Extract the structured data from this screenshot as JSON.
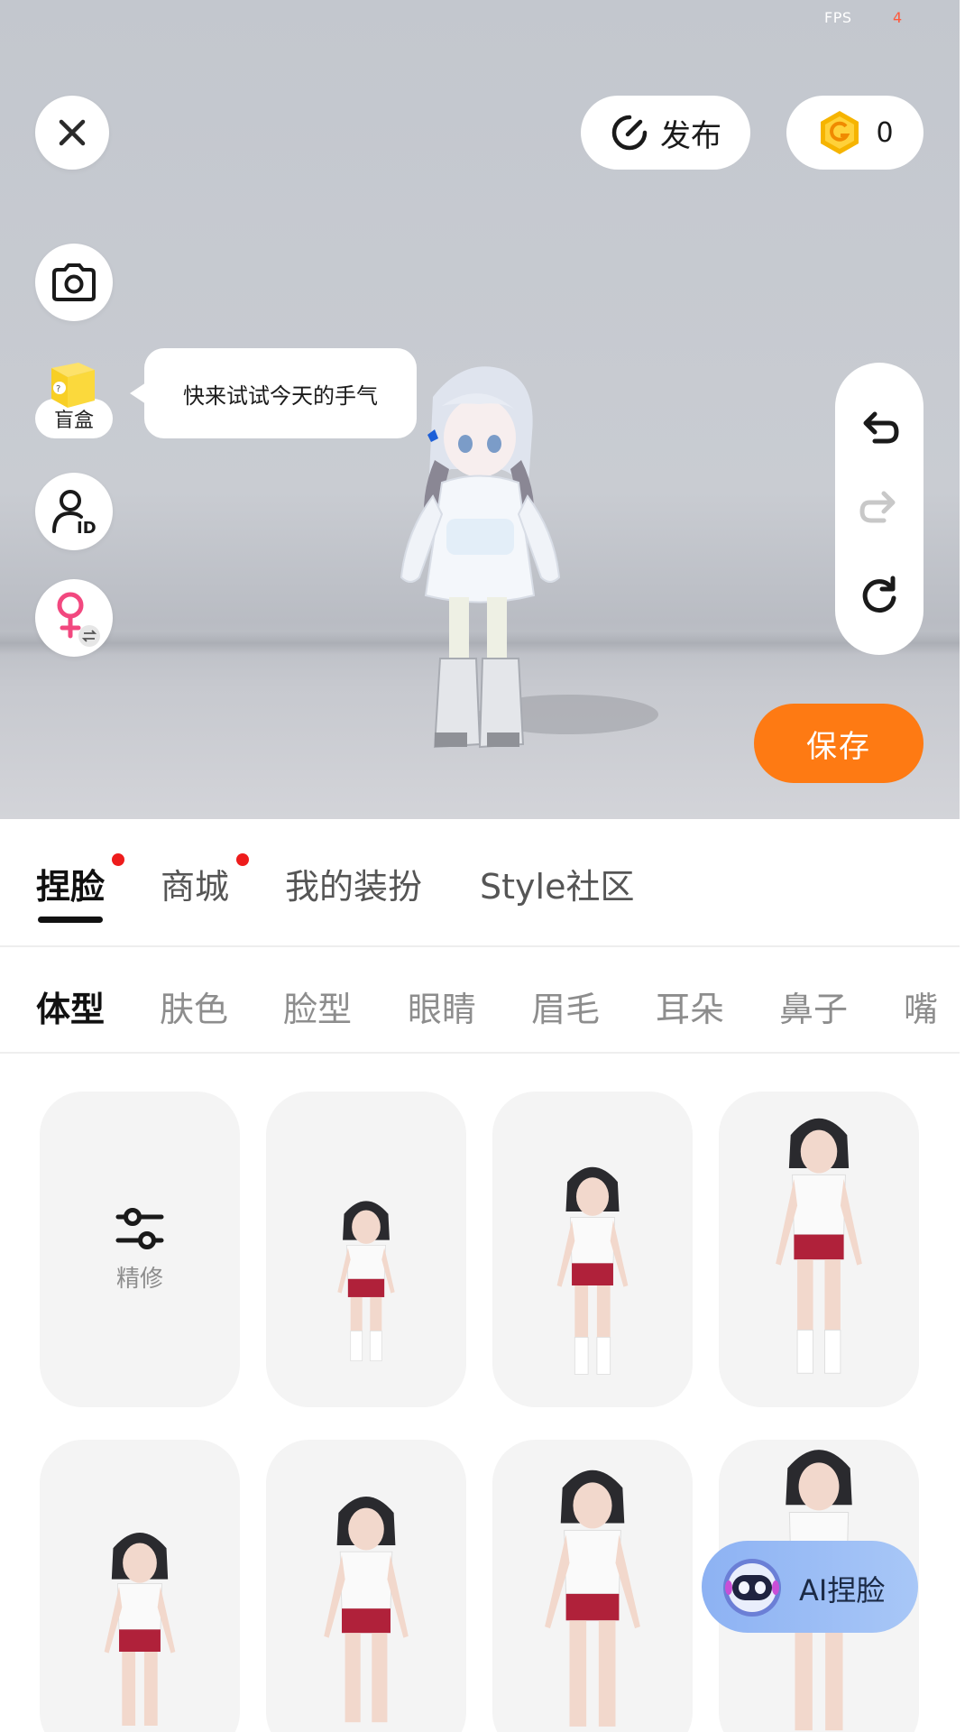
{
  "status": {
    "fps_label": "FPS",
    "fps_value": "4"
  },
  "topbar": {
    "publish_label": "发布",
    "coin_count": "0"
  },
  "left_tools": {
    "blindbox_label": "盲盒",
    "bubble_text": "快来试试今天的手气"
  },
  "actions": {
    "save_label": "保存"
  },
  "main_tabs": [
    {
      "label": "捏脸",
      "active": true,
      "dot": true
    },
    {
      "label": "商城",
      "active": false,
      "dot": true
    },
    {
      "label": "我的装扮",
      "active": false,
      "dot": false
    },
    {
      "label": "Style社区",
      "active": false,
      "dot": false
    }
  ],
  "sub_tabs": [
    {
      "label": "体型",
      "active": true
    },
    {
      "label": "肤色"
    },
    {
      "label": "脸型"
    },
    {
      "label": "眼睛"
    },
    {
      "label": "眉毛"
    },
    {
      "label": "耳朵"
    },
    {
      "label": "鼻子"
    },
    {
      "label": "嘴"
    }
  ],
  "grid": {
    "refine_label": "精修"
  },
  "ai_button": {
    "label": "AI捏脸"
  },
  "colors": {
    "accent": "#fe7a13",
    "dot": "#ee1c1c",
    "coin": "#f6b400",
    "ai_gradient_start": "#8db2f3"
  },
  "icons": [
    "close-icon",
    "publish-icon",
    "coin-icon",
    "camera-icon",
    "blindbox-icon",
    "profile-id-icon",
    "gender-female-icon",
    "undo-icon",
    "redo-icon",
    "reset-icon",
    "sliders-icon",
    "robot-icon"
  ]
}
